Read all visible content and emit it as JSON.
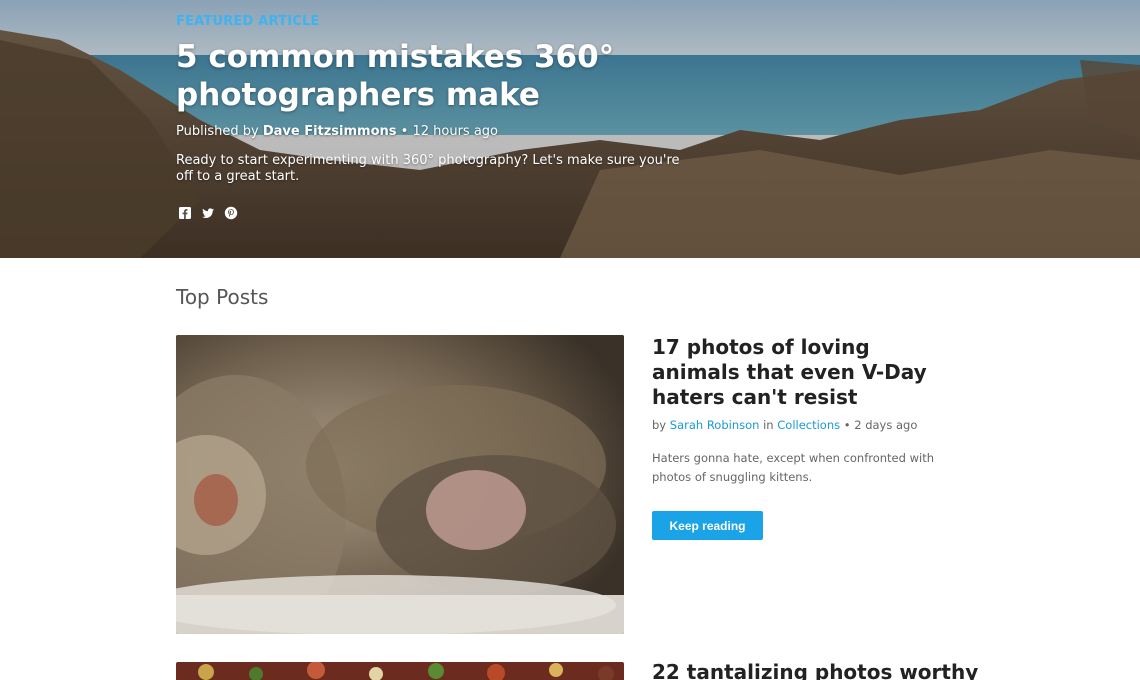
{
  "hero": {
    "label": "FEATURED ARTICLE",
    "title": "5 common mistakes 360° photographers make",
    "meta_prefix": "Published by ",
    "author": "Dave Fitzsimmons",
    "meta_suffix": " • 12 hours ago",
    "summary": "Ready to start experimenting with 360° photography? Let's make sure you're off to a great start.",
    "social_icons": [
      "facebook-icon",
      "twitter-icon",
      "pinterest-icon"
    ],
    "label_color": "#3fb3f0"
  },
  "top_posts": {
    "section_title": "Top Posts",
    "posts": [
      {
        "title": "17 photos of loving animals that even V-Day haters can't resist",
        "by": "by ",
        "author": "Sarah Robinson",
        "in": " in ",
        "category": "Collections",
        "time": " • 2 days ago",
        "excerpt": "Haters gonna hate, except when confronted with photos of snuggling kittens.",
        "button_label": "Keep reading"
      },
      {
        "title": "22 tantalizing photos worthy"
      }
    ],
    "link_color": "#1a9ad8",
    "button_color": "#1aa3e6"
  }
}
